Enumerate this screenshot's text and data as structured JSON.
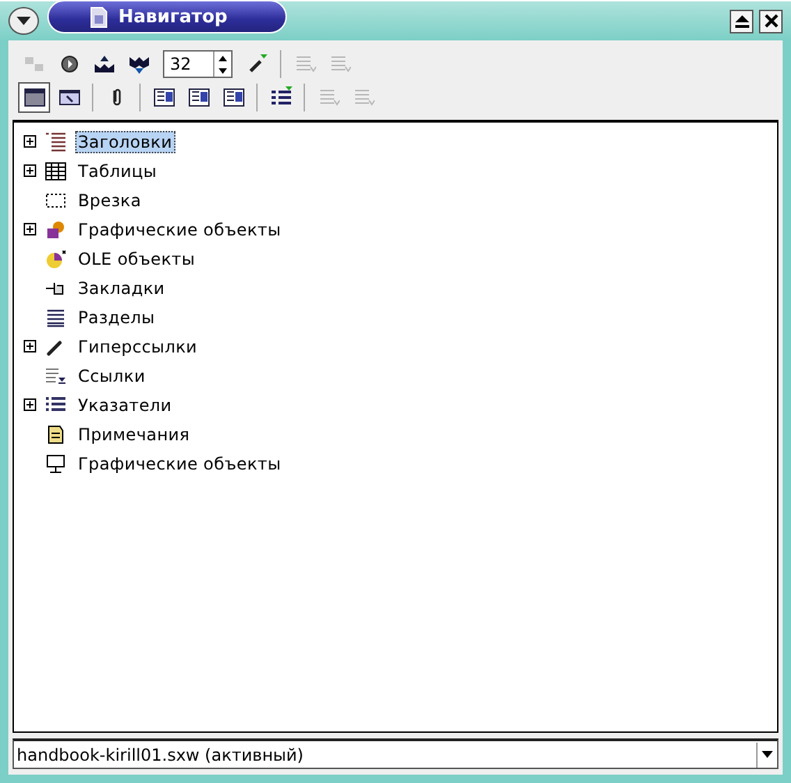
{
  "window": {
    "title": "Навигатор"
  },
  "toolbar": {
    "rows": [
      [
        {
          "kind": "button",
          "disabled": true,
          "pressed": false
        },
        {
          "kind": "button",
          "disabled": false,
          "pressed": false
        },
        {
          "kind": "button",
          "disabled": false,
          "pressed": false
        },
        {
          "kind": "button",
          "disabled": false,
          "pressed": false
        },
        {
          "kind": "spin",
          "value": "32"
        },
        {
          "kind": "button",
          "disabled": false,
          "pressed": false
        },
        {
          "kind": "separator"
        },
        {
          "kind": "button",
          "disabled": true,
          "pressed": false
        },
        {
          "kind": "button",
          "disabled": true,
          "pressed": false
        }
      ],
      [
        {
          "kind": "button",
          "disabled": false,
          "pressed": true
        },
        {
          "kind": "button",
          "disabled": false,
          "pressed": false
        },
        {
          "kind": "separator"
        },
        {
          "kind": "button",
          "disabled": false,
          "pressed": false
        },
        {
          "kind": "separator"
        },
        {
          "kind": "button",
          "disabled": false,
          "pressed": false
        },
        {
          "kind": "button",
          "disabled": false,
          "pressed": false
        },
        {
          "kind": "button",
          "disabled": false,
          "pressed": false
        },
        {
          "kind": "separator"
        },
        {
          "kind": "button",
          "disabled": false,
          "pressed": false
        },
        {
          "kind": "separator"
        },
        {
          "kind": "button",
          "disabled": true,
          "pressed": false
        },
        {
          "kind": "button",
          "disabled": true,
          "pressed": false
        }
      ]
    ]
  },
  "tree": {
    "items": [
      {
        "label": "Заголовки",
        "expandable": true,
        "selected": true
      },
      {
        "label": "Таблицы",
        "expandable": true,
        "selected": false
      },
      {
        "label": "Врезка",
        "expandable": false,
        "selected": false
      },
      {
        "label": "Графические объекты",
        "expandable": true,
        "selected": false
      },
      {
        "label": "OLE объекты",
        "expandable": false,
        "selected": false
      },
      {
        "label": "Закладки",
        "expandable": false,
        "selected": false
      },
      {
        "label": "Разделы",
        "expandable": false,
        "selected": false
      },
      {
        "label": "Гиперссылки",
        "expandable": true,
        "selected": false
      },
      {
        "label": "Ссылки",
        "expandable": false,
        "selected": false
      },
      {
        "label": "Указатели",
        "expandable": true,
        "selected": false
      },
      {
        "label": "Примечания",
        "expandable": false,
        "selected": false
      },
      {
        "label": "Графические объекты",
        "expandable": false,
        "selected": false
      }
    ]
  },
  "document_select": {
    "value": "handbook-kirill01.sxw (активный)"
  }
}
